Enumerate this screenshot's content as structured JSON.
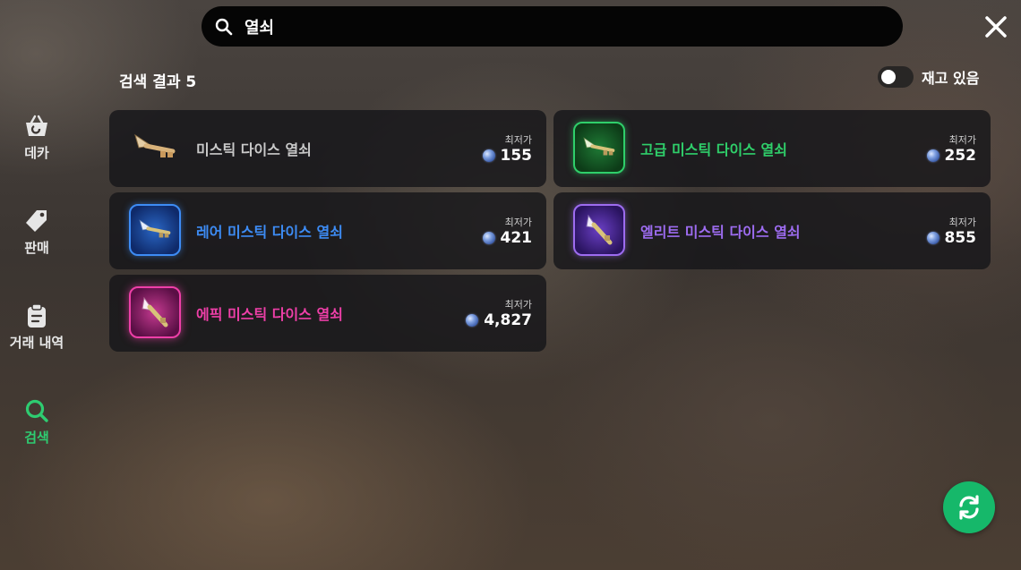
{
  "search": {
    "query": "열쇠",
    "icon": "search-icon"
  },
  "result_count_label": "검색 결과 5",
  "stock_filter": {
    "label": "재고 있음",
    "enabled": false
  },
  "sidebar": {
    "items": [
      {
        "label": "데카",
        "icon": "shopping-basket-icon",
        "active": false
      },
      {
        "label": "판매",
        "icon": "tag-icon",
        "active": false
      },
      {
        "label": "거래 내역",
        "icon": "clipboard-icon",
        "active": false
      },
      {
        "label": "검색",
        "icon": "search-icon",
        "active": true
      }
    ]
  },
  "results": [
    {
      "name": "미스틱 다이스 열쇠",
      "price_label": "최저가",
      "price": "155",
      "grade": "common",
      "color": "#c9c9c9"
    },
    {
      "name": "고급 미스틱 다이스 열쇠",
      "price_label": "최저가",
      "price": "252",
      "grade": "uncommon",
      "color": "#2fcf6a"
    },
    {
      "name": "레어 미스틱 다이스 열쇠",
      "price_label": "최저가",
      "price": "421",
      "grade": "rare",
      "color": "#3d8cf5"
    },
    {
      "name": "엘리트 미스틱 다이스 열쇠",
      "price_label": "최저가",
      "price": "855",
      "grade": "elite",
      "color": "#9d6cf0"
    },
    {
      "name": "에픽 미스틱 다이스 열쇠",
      "price_label": "최저가",
      "price": "4,827",
      "grade": "epic",
      "color": "#ee3fa8"
    }
  ],
  "colors": {
    "accent": "#16b86a",
    "active_nav": "#2ecc71"
  }
}
